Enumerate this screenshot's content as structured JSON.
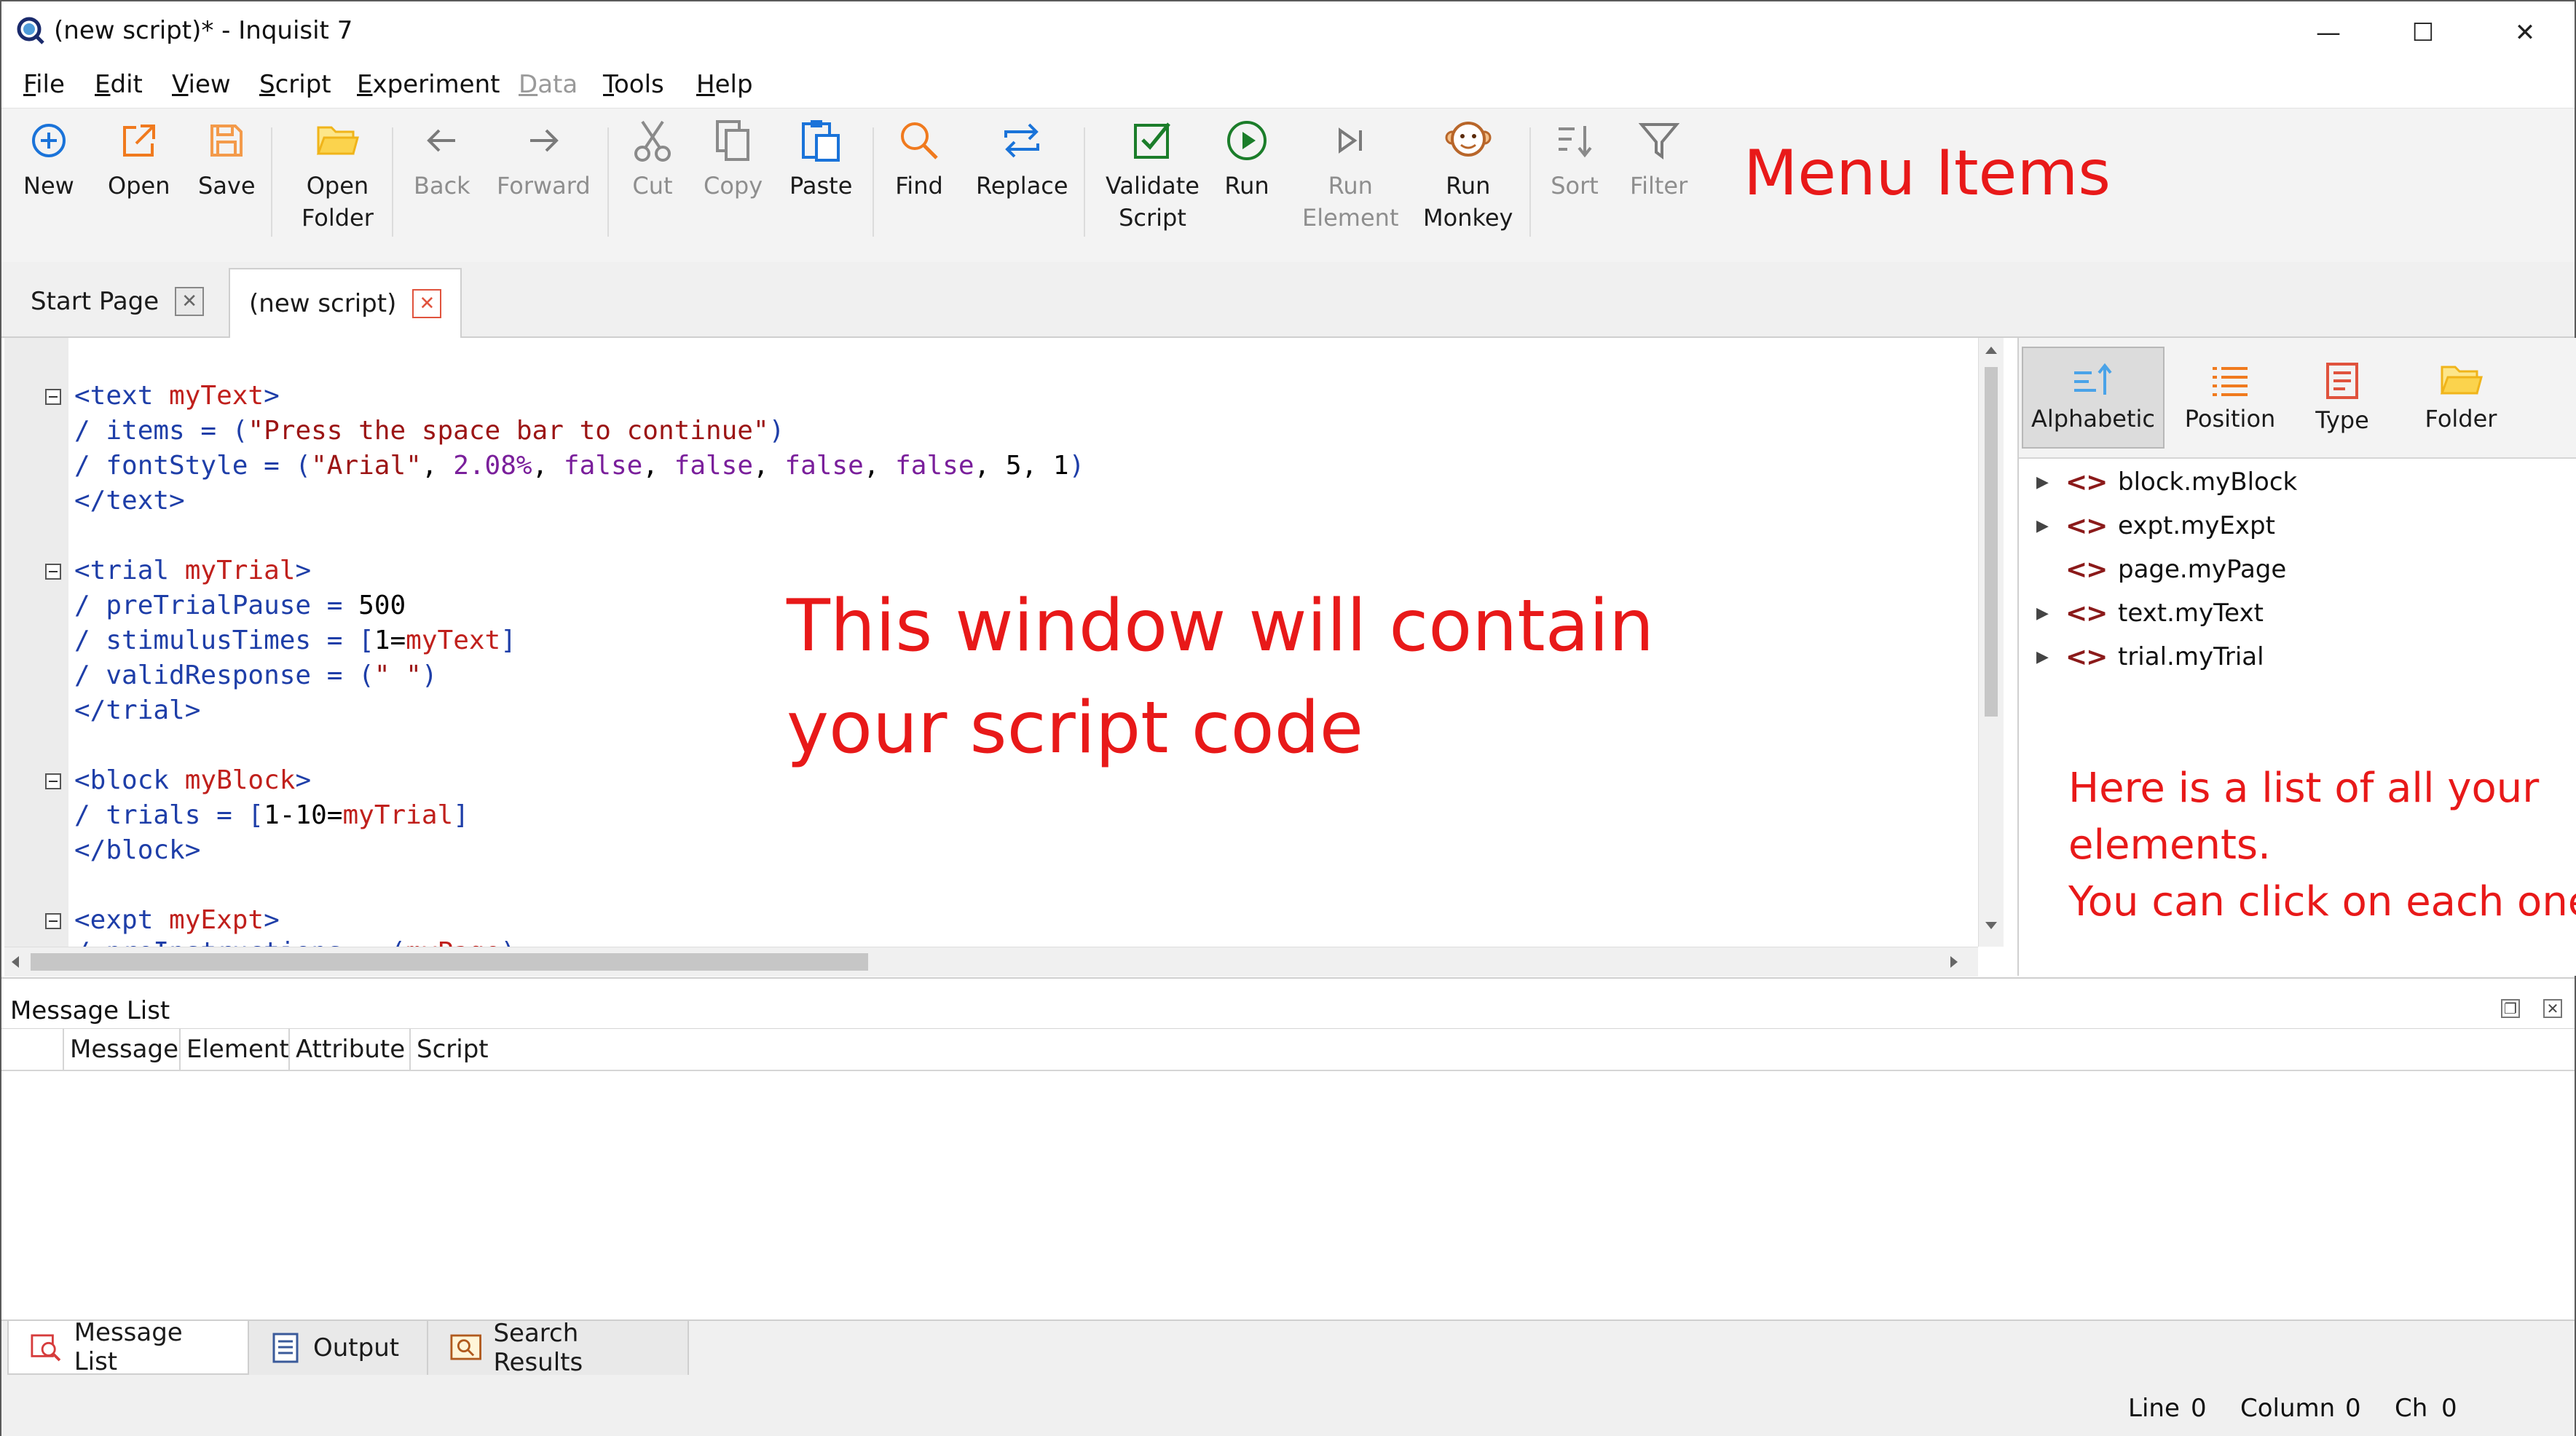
{
  "window": {
    "title": "(new script)* - Inquisit 7",
    "minimize": "—",
    "maximize": "☐",
    "close": "✕"
  },
  "menubar": {
    "items": [
      {
        "key": "F",
        "rest": "ile"
      },
      {
        "key": "E",
        "rest": "dit"
      },
      {
        "key": "V",
        "rest": "iew"
      },
      {
        "key": "S",
        "rest": "cript"
      },
      {
        "key": "E",
        "rest": "xperiment"
      },
      {
        "key": "D",
        "rest": "ata"
      },
      {
        "key": "T",
        "rest": "ools"
      },
      {
        "key": "H",
        "rest": "elp"
      }
    ]
  },
  "toolbar": {
    "new": "New",
    "open": "Open",
    "save": "Save",
    "open_folder_1": "Open",
    "open_folder_2": "Folder",
    "back": "Back",
    "forward": "Forward",
    "cut": "Cut",
    "copy": "Copy",
    "paste": "Paste",
    "find": "Find",
    "replace": "Replace",
    "validate_1": "Validate",
    "validate_2": "Script",
    "run": "Run",
    "run_element_1": "Run",
    "run_element_2": "Element",
    "run_monkey_1": "Run",
    "run_monkey_2": "Monkey",
    "sort": "Sort",
    "filter": "Filter",
    "annotation": "Menu Items",
    "colors": {
      "blue": "#1a73d9",
      "orange": "#f07a1e",
      "green": "#1b7d2a",
      "gray": "#8e8e8e",
      "red": "#e81919"
    }
  },
  "tabs": {
    "start_page": "Start Page",
    "new_script": "(new script)",
    "close_glyph": "✕"
  },
  "editor": {
    "annotation_line1": "This window will contain",
    "annotation_line2": "your script code",
    "lines": {
      "l1a": "<text",
      "l1b": " myText",
      "l1c": ">",
      "l2a": "/ items = (",
      "l2b": "\"Press the space bar to continue\"",
      "l2c": ")",
      "l3a": "/ fontStyle = (",
      "l3b": "\"Arial\"",
      "l3c": ", ",
      "l3d": "2.08%",
      "l3e": ", ",
      "l3f": "false",
      "l3g": ", ",
      "l3h": "false",
      "l3i": ", ",
      "l3j": "false",
      "l3k": ", ",
      "l3l": "false",
      "l3m": ", ",
      "l3n": "5",
      "l3o": ", ",
      "l3p": "1",
      "l3q": ")",
      "l4": "</text>",
      "l6a": "<trial",
      "l6b": " myTrial",
      "l6c": ">",
      "l7a": "/ preTrialPause = ",
      "l7b": "500",
      "l8a": "/ stimulusTimes = [",
      "l8b": "1=",
      "l8c": "myText",
      "l8d": "]",
      "l9a": "/ validResponse = (",
      "l9b": "\" \"",
      "l9c": ")",
      "l10": "</trial>",
      "l12a": "<block",
      "l12b": " myBlock",
      "l12c": ">",
      "l13a": "/ trials = [",
      "l13b": "1-10=",
      "l13c": "myTrial",
      "l13d": "]",
      "l14": "</block>",
      "l16a": "<expt",
      "l16b": " myExpt",
      "l16c": ">",
      "l17a": "/ preInstructions = (",
      "l17b": "myPage",
      "l17c": ")"
    }
  },
  "elements_panel": {
    "sort_alphabetic": "Alphabetic",
    "sort_position": "Position",
    "sort_type": "Type",
    "sort_folder": "Folder",
    "items": [
      {
        "label": "block.myBlock",
        "expandable": true
      },
      {
        "label": "expt.myExpt",
        "expandable": true
      },
      {
        "label": "page.myPage",
        "expandable": false
      },
      {
        "label": "text.myText",
        "expandable": true
      },
      {
        "label": "trial.myTrial",
        "expandable": true
      }
    ],
    "chevron_glyph": "<>",
    "annotation_line1": "Here is a list of all your",
    "annotation_line2": "elements.",
    "annotation_line3": "You can click on each one."
  },
  "message_list": {
    "title": "Message List",
    "columns": [
      "Message",
      "Element",
      "Attribute",
      "Script"
    ]
  },
  "bottom_tabs": {
    "message_list": "Message List",
    "output": "Output",
    "search_results": "Search Results"
  },
  "status": {
    "line_label": "Line",
    "line_value": "0",
    "column_label": "Column",
    "column_value": "0",
    "ch_label": "Ch",
    "ch_value": "0"
  }
}
